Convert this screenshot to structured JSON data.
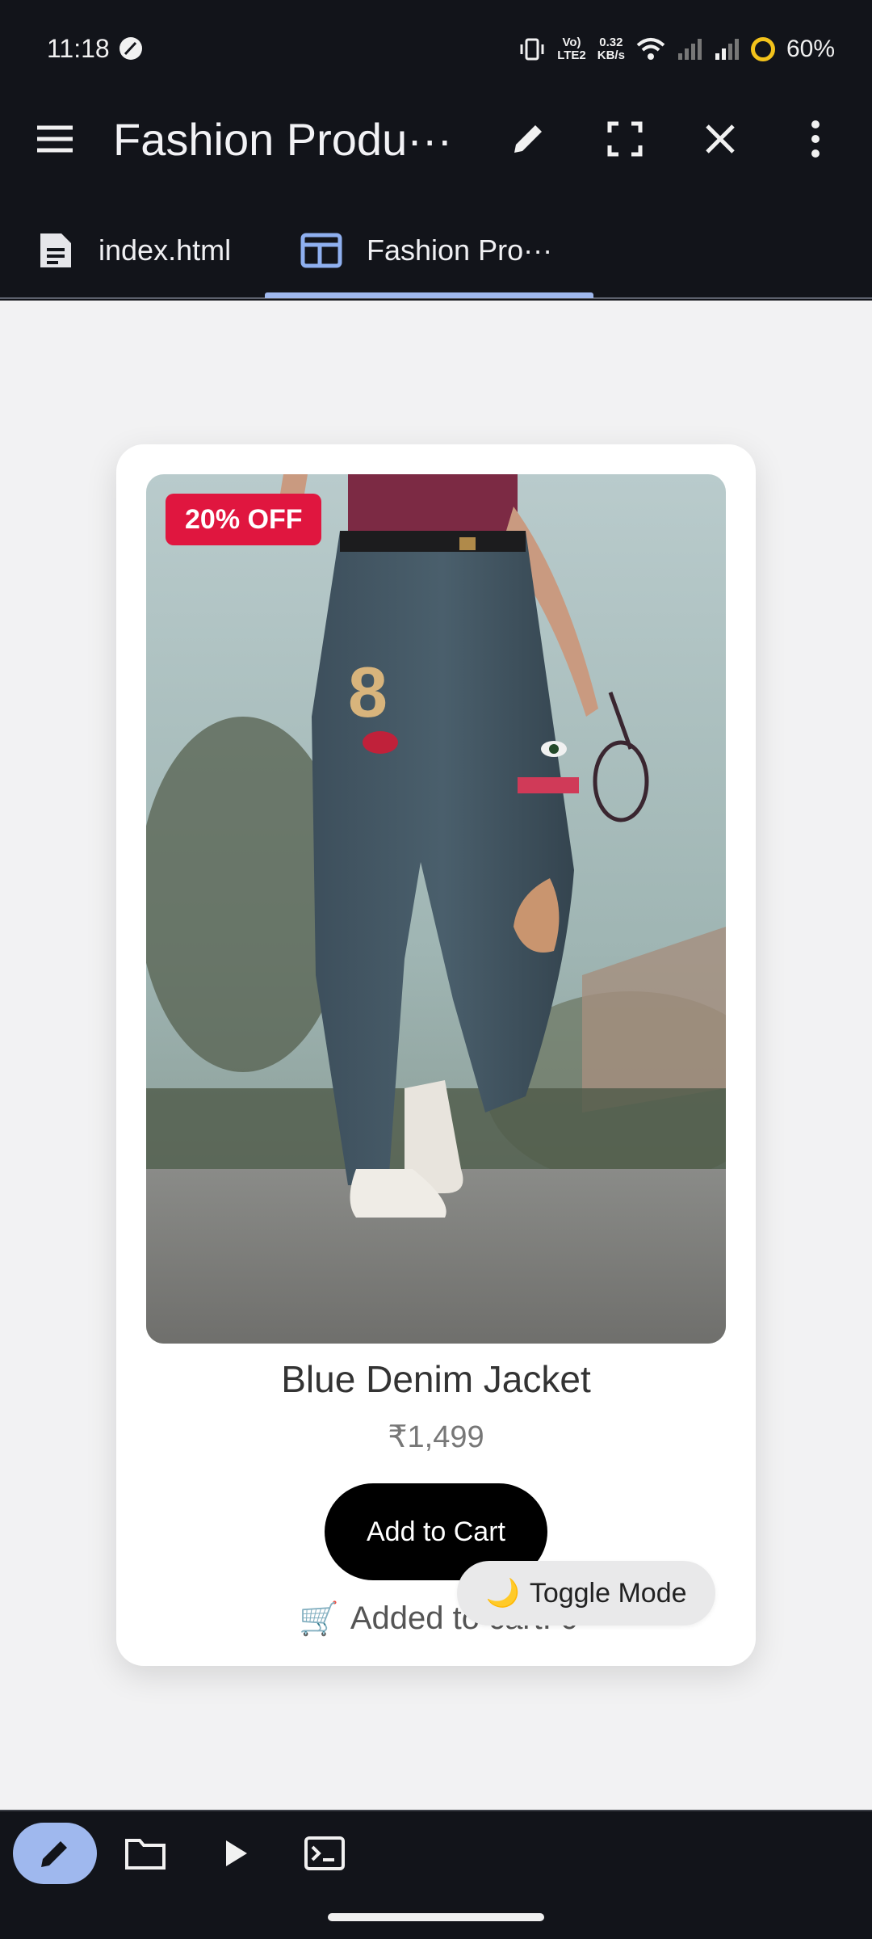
{
  "status_bar": {
    "time": "11:18",
    "network_line1": "Vo)",
    "network_line2": "LTE2",
    "speed_value": "0.32",
    "speed_unit": "KB/s",
    "battery": "60%"
  },
  "appbar": {
    "title": "Fashion Produ···",
    "icons": [
      "menu-icon",
      "pencil-icon",
      "fullscreen-icon",
      "close-icon",
      "more-vert-icon"
    ]
  },
  "tabs": [
    {
      "label": "index.html",
      "icon": "document-icon",
      "active": false
    },
    {
      "label": "Fashion Pro···",
      "icon": "browser-preview-icon",
      "active": true
    }
  ],
  "product": {
    "badge": "20% OFF",
    "name": "Blue Denim Jacket",
    "price": "₹1,499",
    "add_button": "Add to Cart",
    "cart_icon": "🛒",
    "cart_status": "Added to cart: 0"
  },
  "toggle": {
    "icon": "🌙",
    "label": "Toggle Mode"
  },
  "bottom_bar": {
    "icons": [
      "edit-icon",
      "folder-icon",
      "play-icon",
      "terminal-icon"
    ]
  },
  "colors": {
    "chrome_bg": "#12141a",
    "accent": "#9fb8ee",
    "badge_red": "#e0163f",
    "page_bg": "#f2f2f3"
  }
}
